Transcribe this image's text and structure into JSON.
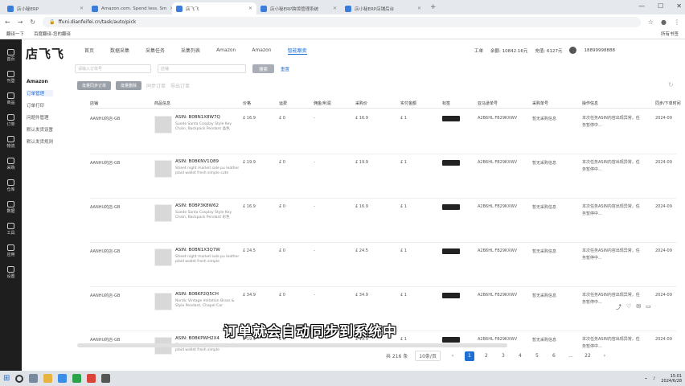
{
  "browser": {
    "tabs": [
      {
        "label": "店小秘ERP",
        "active": false
      },
      {
        "label": "Amazon.com. Spend less. Sm",
        "active": false
      },
      {
        "label": "店飞飞",
        "active": true
      },
      {
        "label": "店小秘ERP跨境管理系统",
        "active": false
      },
      {
        "label": "店小秘ERP店铺后台",
        "active": false
      }
    ],
    "newtab": "+",
    "url": "ffuni.dianfeifei.cn/task/auto/pick",
    "bookmarks": [
      "翻译一下",
      "百度翻译-您的翻译"
    ],
    "bookmarks_right": "所有书签"
  },
  "sidebar": [
    {
      "label": "首页",
      "icon": "home-icon"
    },
    {
      "label": "刊登",
      "icon": "publish-icon"
    },
    {
      "label": "商品",
      "icon": "product-icon"
    },
    {
      "label": "订单",
      "icon": "order-icon"
    },
    {
      "label": "物流",
      "icon": "shipping-icon"
    },
    {
      "label": "采购",
      "icon": "purchase-icon"
    },
    {
      "label": "仓库",
      "icon": "warehouse-icon"
    },
    {
      "label": "数据",
      "icon": "data-icon"
    },
    {
      "label": "工具",
      "icon": "tool-icon"
    },
    {
      "label": "应用",
      "icon": "app-icon"
    },
    {
      "label": "设置",
      "icon": "settings-icon"
    }
  ],
  "logo": "店飞飞",
  "topnav": [
    "首页",
    "数据采集",
    "采集任务",
    "采集列表",
    "Amazon",
    "Amazon",
    "智能跟卖"
  ],
  "topright": {
    "label": "工单",
    "balance": "余额: 10842.16元",
    "bonus": "充值: 6127元",
    "phone": "18899998888"
  },
  "leftnav": {
    "heading": "Amazon",
    "items": [
      "订单管理",
      "订单打印",
      "问题件管理",
      "默认发货设置",
      "默认发货规则"
    ]
  },
  "search": {
    "placeholder1": "请输入订单号",
    "placeholder2": "店铺",
    "button": "搜索",
    "reset": "重置"
  },
  "actions": {
    "btn1": "批量同步订单",
    "btn2": "批量删除",
    "link1": "同步订单",
    "link2": "导出订单"
  },
  "columns": [
    "店铺",
    "商品信息",
    "价格",
    "运费",
    "佣金/利润",
    "采购价",
    "实付金额",
    "标签",
    "亚马逊单号",
    "采购单号",
    "操作信息",
    "同步/下单时间"
  ],
  "rows": [
    {
      "shop": "AANHU的店-GB",
      "asin": "ASIN: B0BN1X8W7Q",
      "desc": "Suede Santa Cosplay Style Key Chain, Backpack Pendant 晶色",
      "price": "£ 16.9",
      "ship": "£ 0",
      "profit": "-",
      "cost": "£ 16.9",
      "paid": "£ 1",
      "amzorder": "A2B6HL FB29KXWV",
      "purchase": "暂无采购信息",
      "info": "本次任务ASIN内容出现异常，任务暂停中...",
      "time": "2024-09"
    },
    {
      "shop": "AANHU的店-GB",
      "asin": "ASIN: B0BKNV1Q89",
      "desc": "Street night market sale pu leather plaid wallet fresh simple cute",
      "price": "£ 19.9",
      "ship": "£ 0",
      "profit": "-",
      "cost": "£ 19.9",
      "paid": "£ 1",
      "amzorder": "A2B6HL FB29KXWV",
      "purchase": "暂无采购信息",
      "info": "本次任务ASIN内容出现异常，任务暂停中...",
      "time": "2024-09"
    },
    {
      "shop": "AANHU的店-GB",
      "asin": "ASIN: B0BP3K8W62",
      "desc": "Suede Santa Cosplay Style Key Chain, Backpack Pendant 彩色",
      "price": "£ 16.9",
      "ship": "£ 0",
      "profit": "-",
      "cost": "£ 16.9",
      "paid": "£ 1",
      "amzorder": "A2B6HL FB29KXWV",
      "purchase": "暂无采购信息",
      "info": "本次任务ASIN内容出现异常，任务暂停中...",
      "time": "2024-09"
    },
    {
      "shop": "AANHU的店-GB",
      "asin": "ASIN: B0BN1X3Q7W",
      "desc": "Street night market sale pu leather plaid wallet fresh simple",
      "price": "£ 24.5",
      "ship": "£ 0",
      "profit": "-",
      "cost": "£ 24.5",
      "paid": "£ 1",
      "amzorder": "A2B6HL FB29KXWV",
      "purchase": "暂无采购信息",
      "info": "本次任务ASIN内容出现异常，任务暂停中...",
      "time": "2024-09"
    },
    {
      "shop": "AANHU的店-GB",
      "asin": "ASIN: B0BKP2Q5CH",
      "desc": "Nordic Vintage Imitation Brass & Style Pendant, Chapel Car",
      "price": "£ 34.9",
      "ship": "£ 0",
      "profit": "-",
      "cost": "£ 34.9",
      "paid": "£ 1",
      "amzorder": "A2B6HL FB29KXWV",
      "purchase": "暂无采购信息",
      "info": "本次任务ASIN内容出现异常，任务暂停中...",
      "time": "2024-09"
    },
    {
      "shop": "AANHU的店-GB",
      "asin": "ASIN: B0BKPWH2X4",
      "desc": "Street night market sale pu leather plaid wallet fresh simple",
      "price": "£ 19.9",
      "ship": "£ 0",
      "profit": "-",
      "cost": "£ 19.9",
      "paid": "£ 1",
      "amzorder": "A2B6HL FB29KXWV",
      "purchase": "暂无采购信息",
      "info": "本次任务ASIN内容出现异常，任务暂停中...",
      "time": "2024-09"
    }
  ],
  "pagination": {
    "total": "共 216 条",
    "per": "10条/页",
    "pages": [
      "1",
      "2",
      "3",
      "4",
      "5",
      "6",
      "...",
      "22"
    ],
    "current": "1"
  },
  "subtitle": "订单就会自动同步到系统中",
  "taskbar": {
    "time": "15:01",
    "date": "2024/6/28"
  }
}
